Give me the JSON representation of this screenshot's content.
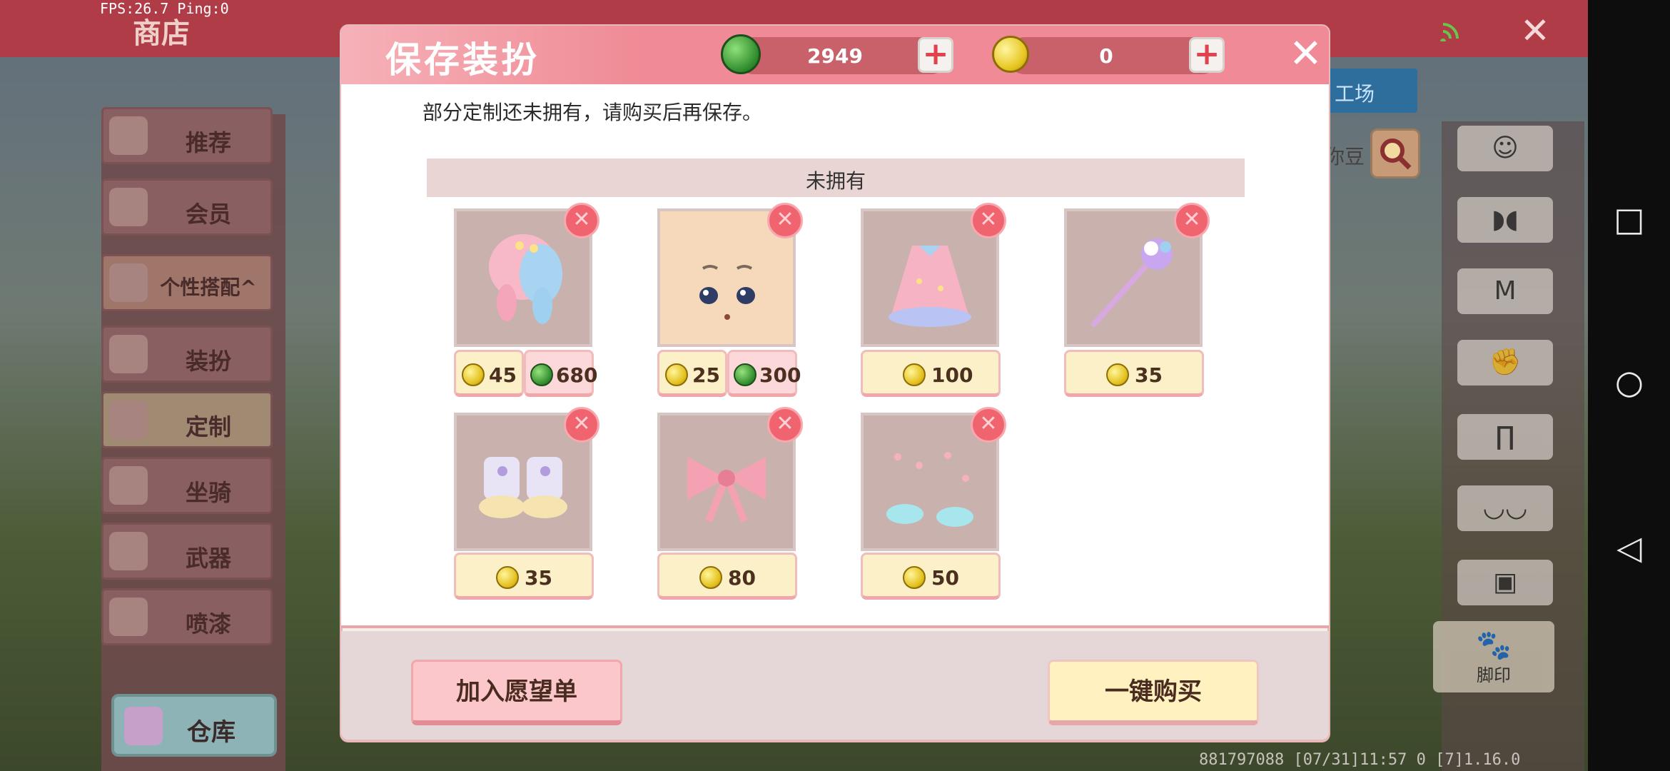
{
  "hud": {
    "fps": "FPS:26.7  Ping:0"
  },
  "shop": {
    "title": "商店",
    "close_glyph": "✕",
    "tab_label": "工场",
    "search_hint": "你豆",
    "sidebar": [
      {
        "label": "推荐",
        "icon": "recommend-icon"
      },
      {
        "label": "会员",
        "icon": "vip-icon"
      },
      {
        "label": "个性搭配^",
        "icon": "star-icon"
      },
      {
        "label": "装扮",
        "icon": "tshirt-icon"
      },
      {
        "label": "定制",
        "icon": "customize-icon"
      },
      {
        "label": "坐骑",
        "icon": "mount-icon"
      },
      {
        "label": "武器",
        "icon": "weapon-icon"
      },
      {
        "label": "喷漆",
        "icon": "spray-icon"
      }
    ],
    "warehouse_label": "仓库",
    "categories": [
      "face-icon",
      "mask-icon",
      "shirt-icon",
      "glove-icon",
      "pants-icon",
      "shoes-icon",
      "backpack-icon"
    ],
    "footprint_label": "脚印",
    "bottom_info": "881797088    [07/31]11:57 0    [7]1.16.0"
  },
  "dialog": {
    "title": "保存装扮",
    "gems": "2949",
    "coins": "0",
    "message": "部分定制还未拥有，请购买后再保存。",
    "section_title": "未拥有",
    "items": [
      {
        "name": "hair",
        "coin": "45",
        "gem": "680"
      },
      {
        "name": "face",
        "coin": "25",
        "gem": "300"
      },
      {
        "name": "dress",
        "coin": "100"
      },
      {
        "name": "wand",
        "coin": "35"
      },
      {
        "name": "shoes",
        "coin": "35"
      },
      {
        "name": "bow",
        "coin": "80"
      },
      {
        "name": "footprint",
        "coin": "50"
      }
    ],
    "wishlist_label": "加入愿望单",
    "buy_all_label": "一键购买"
  },
  "android_nav": {
    "square": "□",
    "circle": "○",
    "back": "◁"
  },
  "colors": {
    "header_pink": "#f08a96",
    "price_bg": "#fbf0c8",
    "remove_red": "#f06470"
  }
}
